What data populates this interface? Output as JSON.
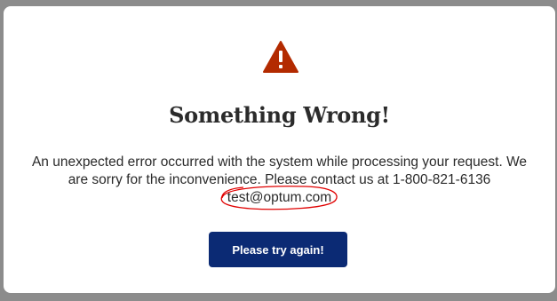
{
  "dialog": {
    "icon": "warning-triangle-icon",
    "title": "Something Wrong!",
    "message_line1": "An unexpected error occurred with the system while processing your request. We are sorry for the inconvenience. Please contact us at 1-800-821-6136",
    "email": "test@optum.com",
    "button_label": "Please try again!"
  },
  "colors": {
    "icon": "#b32a00",
    "button": "#0b2a74",
    "annotation": "#e00000"
  }
}
